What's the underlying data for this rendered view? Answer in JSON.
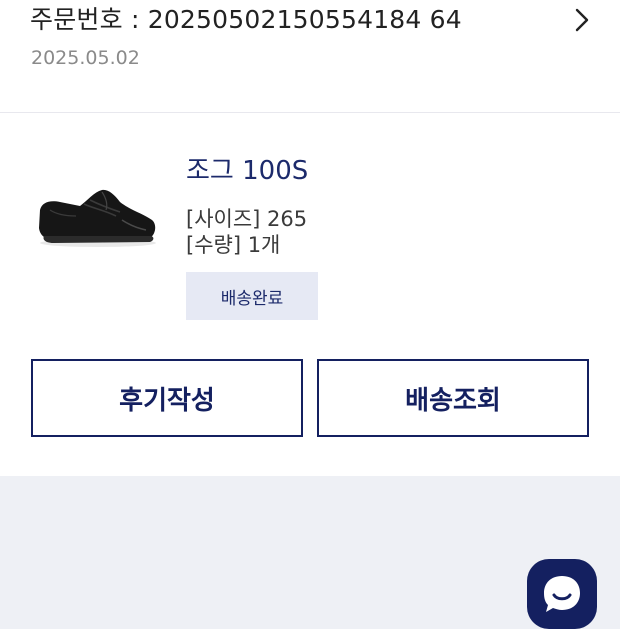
{
  "order": {
    "number_text": "주문번호 : 20250502150554184 64",
    "date": "2025.05.02"
  },
  "product": {
    "name": "조그 100S",
    "size_text": "[사이즈] 265",
    "qty_text": "[수량] 1개",
    "status": "배송완료"
  },
  "actions": {
    "review_label": "후기작성",
    "track_label": "배송조회"
  },
  "icons": {
    "chevron": "chevron-right-icon",
    "chat": "chat-bubble-icon"
  },
  "colors": {
    "brand_navy": "#142060",
    "badge_bg": "#e6e9f4",
    "page_bg": "#eef0f5"
  }
}
